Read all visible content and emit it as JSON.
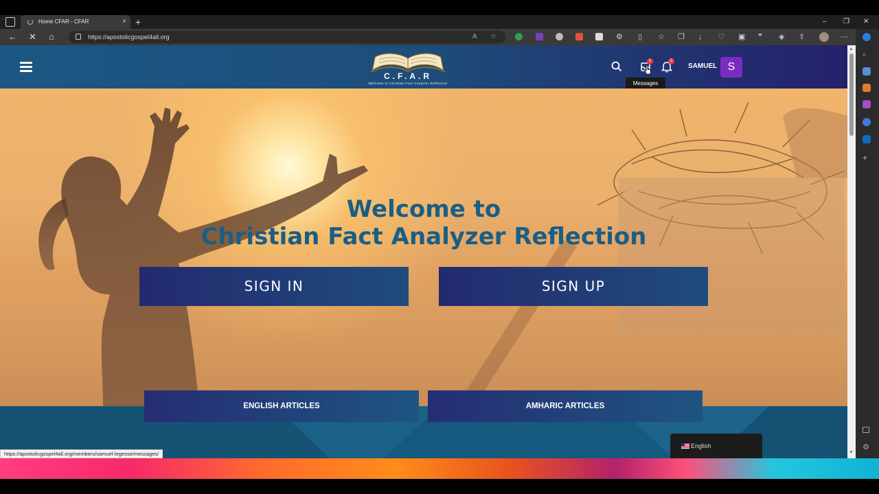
{
  "browser": {
    "tab_title": "Home CFAR - CFAR",
    "tab_close": "×",
    "new_tab": "+",
    "url": "https://apostolicgospel4all.org",
    "window_controls": [
      "–",
      "❐",
      "✕"
    ],
    "status_url": "https://apostolicgospel4all.org/members/samuel-legesse/messages/"
  },
  "header": {
    "logo_letters": "C.F.A.R",
    "logo_tagline": "Welcome to Christian Fact Analyzer Reflection",
    "messages_badge": "1",
    "notifications_badge": "2",
    "username": "SAMUEL",
    "avatar_initial": "S",
    "tooltip": "Messages"
  },
  "hero": {
    "title_line1": "Welcome to",
    "title_line2": "Christian Fact Analyzer Reflection",
    "sign_in": "SIGN IN",
    "sign_up": "SIGN UP"
  },
  "articles": {
    "english": "ENGLISH ARTICLES",
    "amharic": "AMHARIC ARTICLES"
  },
  "language": {
    "current": "English"
  },
  "colors": {
    "header_start": "#1c5784",
    "header_end": "#25206a",
    "title_blue": "#1b5e85",
    "avatar_purple": "#7b2cbf",
    "badge_red": "#e63946"
  }
}
